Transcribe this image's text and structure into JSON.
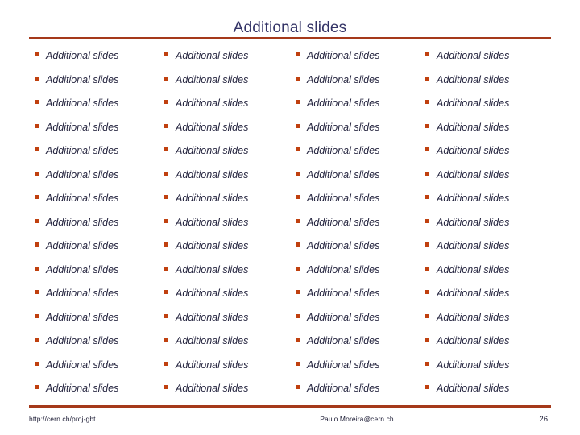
{
  "slide": {
    "title": "Additional slides",
    "accent_color": "#A5391A",
    "bullet_color": "#C0400F",
    "title_color": "#333366",
    "text_color": "#262640",
    "background_color": "#FFFFFF",
    "columns": 4,
    "rows": 15,
    "bullet_glyph": "square-bullet",
    "grid": [
      [
        "Additional slides",
        "Additional slides",
        "Additional slides",
        "Additional slides"
      ],
      [
        "Additional slides",
        "Additional slides",
        "Additional slides",
        "Additional slides"
      ],
      [
        "Additional slides",
        "Additional slides",
        "Additional slides",
        "Additional slides"
      ],
      [
        "Additional slides",
        "Additional slides",
        "Additional slides",
        "Additional slides"
      ],
      [
        "Additional slides",
        "Additional slides",
        "Additional slides",
        "Additional slides"
      ],
      [
        "Additional slides",
        "Additional slides",
        "Additional slides",
        "Additional slides"
      ],
      [
        "Additional slides",
        "Additional slides",
        "Additional slides",
        "Additional slides"
      ],
      [
        "Additional slides",
        "Additional slides",
        "Additional slides",
        "Additional slides"
      ],
      [
        "Additional slides",
        "Additional slides",
        "Additional slides",
        "Additional slides"
      ],
      [
        "Additional slides",
        "Additional slides",
        "Additional slides",
        "Additional slides"
      ],
      [
        "Additional slides",
        "Additional slides",
        "Additional slides",
        "Additional slides"
      ],
      [
        "Additional slides",
        "Additional slides",
        "Additional slides",
        "Additional slides"
      ],
      [
        "Additional slides",
        "Additional slides",
        "Additional slides",
        "Additional slides"
      ],
      [
        "Additional slides",
        "Additional slides",
        "Additional slides",
        "Additional slides"
      ],
      [
        "Additional slides",
        "Additional slides",
        "Additional slides",
        "Additional slides"
      ]
    ]
  },
  "footer": {
    "url": "http://cern.ch/proj-gbt",
    "email": "Paulo.Moreira@cern.ch",
    "page_number": "26"
  }
}
